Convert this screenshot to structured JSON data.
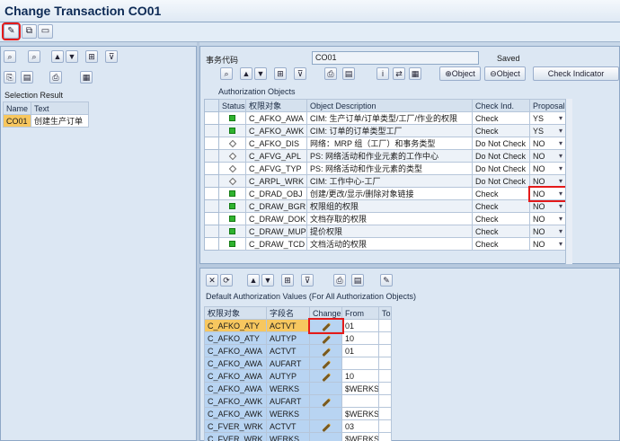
{
  "window": {
    "title": "Change Transaction CO01"
  },
  "left_pane": {
    "selection_result_label": "Selection Result",
    "columns": [
      "Name",
      "Text"
    ],
    "rows": [
      {
        "name": "CO01",
        "text": "创建生产订单"
      }
    ]
  },
  "header": {
    "tcode_label": "事务代码",
    "tcode_value": "CO01",
    "status": "Saved"
  },
  "auth_toolbar": {
    "object_btn1": "Object",
    "object_btn2": "Object",
    "check_indicator_btn": "Check Indicator"
  },
  "auth_objects": {
    "title": "Authorization Objects",
    "columns": [
      "Status",
      "权限对象",
      "Object Description",
      "Check Ind.",
      "Proposal"
    ],
    "rows": [
      {
        "status": "green",
        "object": "C_AFKO_AWA",
        "desc": "CIM: 生产订单/订单类型/工厂/作业的权限",
        "check": "Check",
        "proposal": "YS"
      },
      {
        "status": "green",
        "object": "C_AFKO_AWK",
        "desc": "CIM: 订单的订单类型工厂",
        "check": "Check",
        "proposal": "YS"
      },
      {
        "status": "inactive",
        "object": "C_AFKO_DIS",
        "desc": "网络：MRP 组（工厂）和事务类型",
        "check": "Do Not Check",
        "proposal": "NO"
      },
      {
        "status": "inactive",
        "object": "C_AFVG_APL",
        "desc": "PS: 网络活动和作业元素的工作中心",
        "check": "Do Not Check",
        "proposal": "NO"
      },
      {
        "status": "inactive",
        "object": "C_AFVG_TYP",
        "desc": "PS: 网络活动和作业元素的类型",
        "check": "Do Not Check",
        "proposal": "NO"
      },
      {
        "status": "inactive",
        "object": "C_ARPL_WRK",
        "desc": "CIM: 工作中心-工厂",
        "check": "Do Not Check",
        "proposal": "NO"
      },
      {
        "status": "green",
        "object": "C_DRAD_OBJ",
        "desc": "创建/更改/显示/删除对象链接",
        "check": "Check",
        "proposal": "NO"
      },
      {
        "status": "green",
        "object": "C_DRAW_BGR",
        "desc": "权限组的权限",
        "check": "Check",
        "proposal": "NO"
      },
      {
        "status": "green",
        "object": "C_DRAW_DOK",
        "desc": "文档存取的权限",
        "check": "Check",
        "proposal": "NO"
      },
      {
        "status": "green",
        "object": "C_DRAW_MUP",
        "desc": "提价权限",
        "check": "Check",
        "proposal": "NO"
      },
      {
        "status": "green",
        "object": "C_DRAW_TCD",
        "desc": "文档活动的权限",
        "check": "Check",
        "proposal": "NO"
      }
    ]
  },
  "default_values": {
    "title": "Default Authorization Values (For All Authorization Objects)",
    "columns": [
      "权限对象",
      "字段名",
      "Change",
      "From",
      "To"
    ],
    "rows": [
      {
        "object": "C_AFKO_ATY",
        "field": "ACTVT",
        "pencil": true,
        "from": "01",
        "to": ""
      },
      {
        "object": "C_AFKO_ATY",
        "field": "AUTYP",
        "pencil": true,
        "from": "10",
        "to": ""
      },
      {
        "object": "C_AFKO_AWA",
        "field": "ACTVT",
        "pencil": true,
        "from": "01",
        "to": ""
      },
      {
        "object": "C_AFKO_AWA",
        "field": "AUFART",
        "pencil": true,
        "from": "",
        "to": ""
      },
      {
        "object": "C_AFKO_AWA",
        "field": "AUTYP",
        "pencil": true,
        "from": "10",
        "to": ""
      },
      {
        "object": "C_AFKO_AWA",
        "field": "WERKS",
        "pencil": false,
        "from": "$WERKS",
        "to": ""
      },
      {
        "object": "C_AFKO_AWK",
        "field": "AUFART",
        "pencil": true,
        "from": "",
        "to": ""
      },
      {
        "object": "C_AFKO_AWK",
        "field": "WERKS",
        "pencil": false,
        "from": "$WERKS",
        "to": ""
      },
      {
        "object": "C_FVER_WRK",
        "field": "ACTVT",
        "pencil": true,
        "from": "03",
        "to": ""
      },
      {
        "object": "C_FVER_WRK",
        "field": "WERKS",
        "pencil": false,
        "from": "$WERKS",
        "to": ""
      }
    ]
  },
  "colors": {
    "accent_highlight": "#e41a1a",
    "status_green": "#2fb32f",
    "selected_object": "#f7c75f",
    "key_column": "#b8d4f2"
  }
}
